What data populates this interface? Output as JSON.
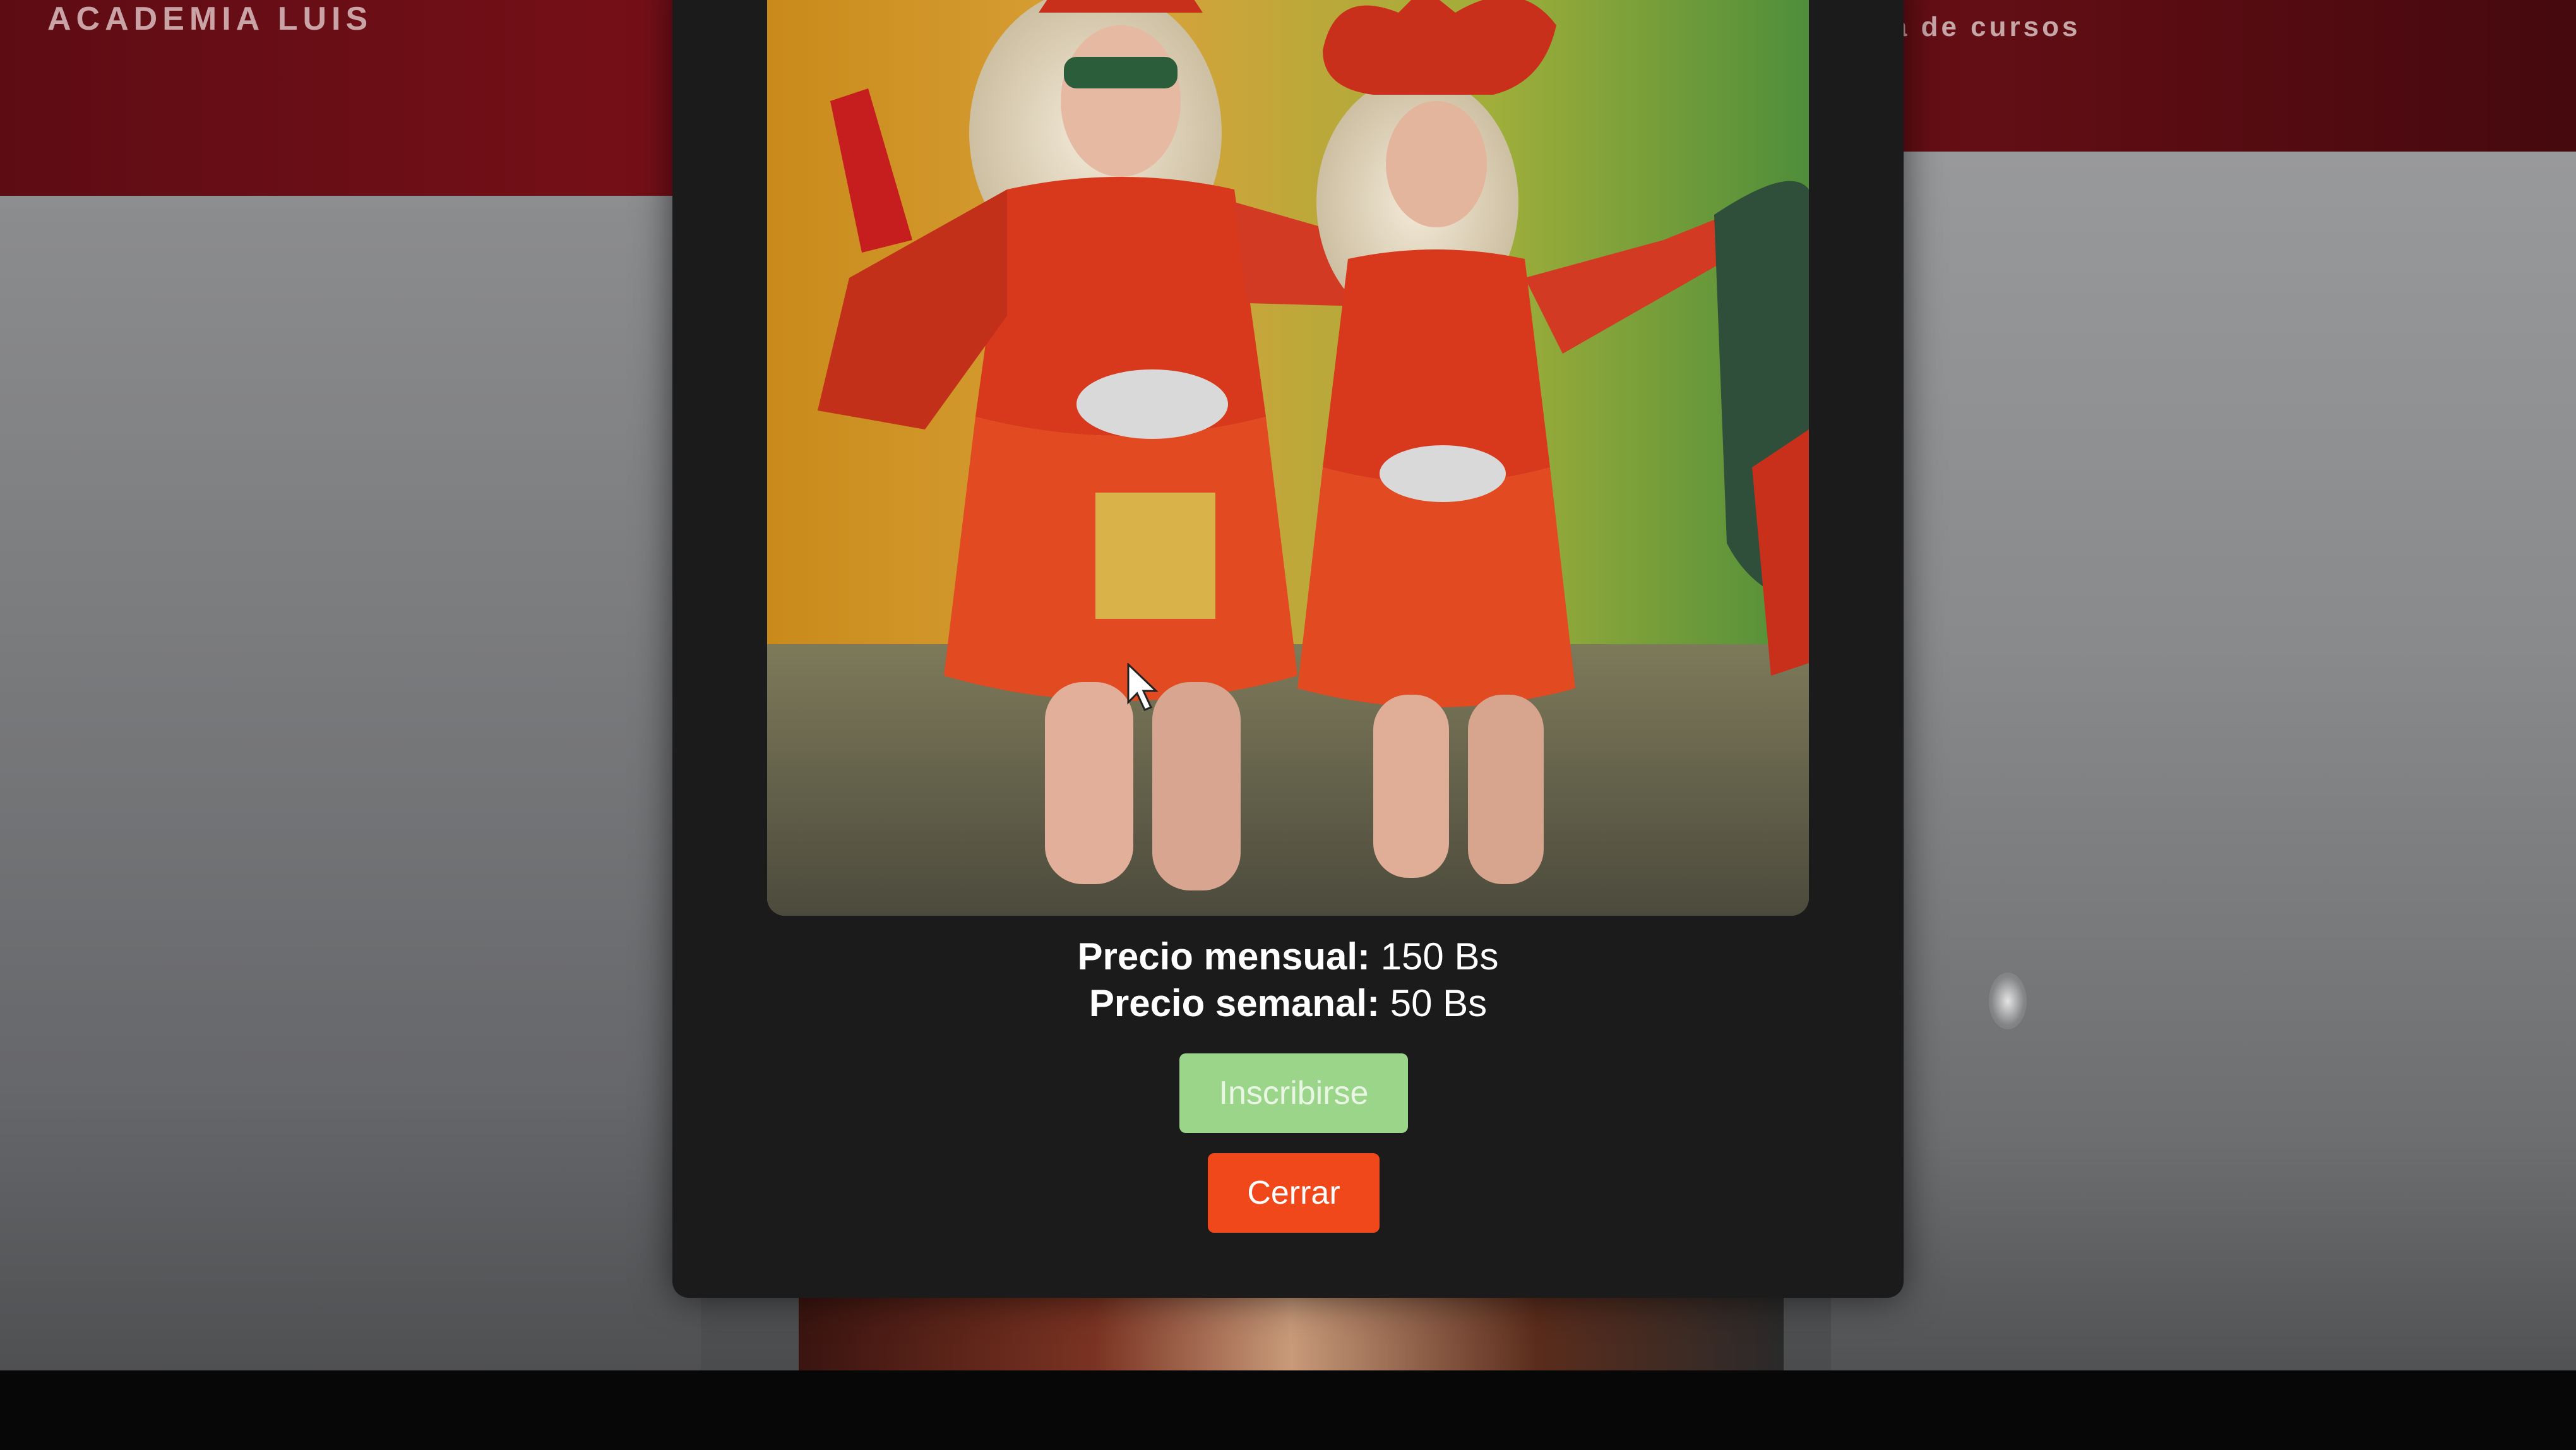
{
  "site": {
    "brand": "ACADEMIA LUIS",
    "nav_offer": "ferta de cursos"
  },
  "modal": {
    "image_icon": "dancers-photo",
    "price_monthly_label": "Precio mensual:",
    "price_monthly_value": "150 Bs",
    "price_weekly_label": "Precio semanal:",
    "price_weekly_value": "50 Bs",
    "enroll_label": "Inscribirse",
    "close_label": "Cerrar"
  },
  "colors": {
    "enroll_button": "#9ad58a",
    "close_button": "#f0481a",
    "header": "#7a1018",
    "modal_bg": "#1b1b1b"
  }
}
